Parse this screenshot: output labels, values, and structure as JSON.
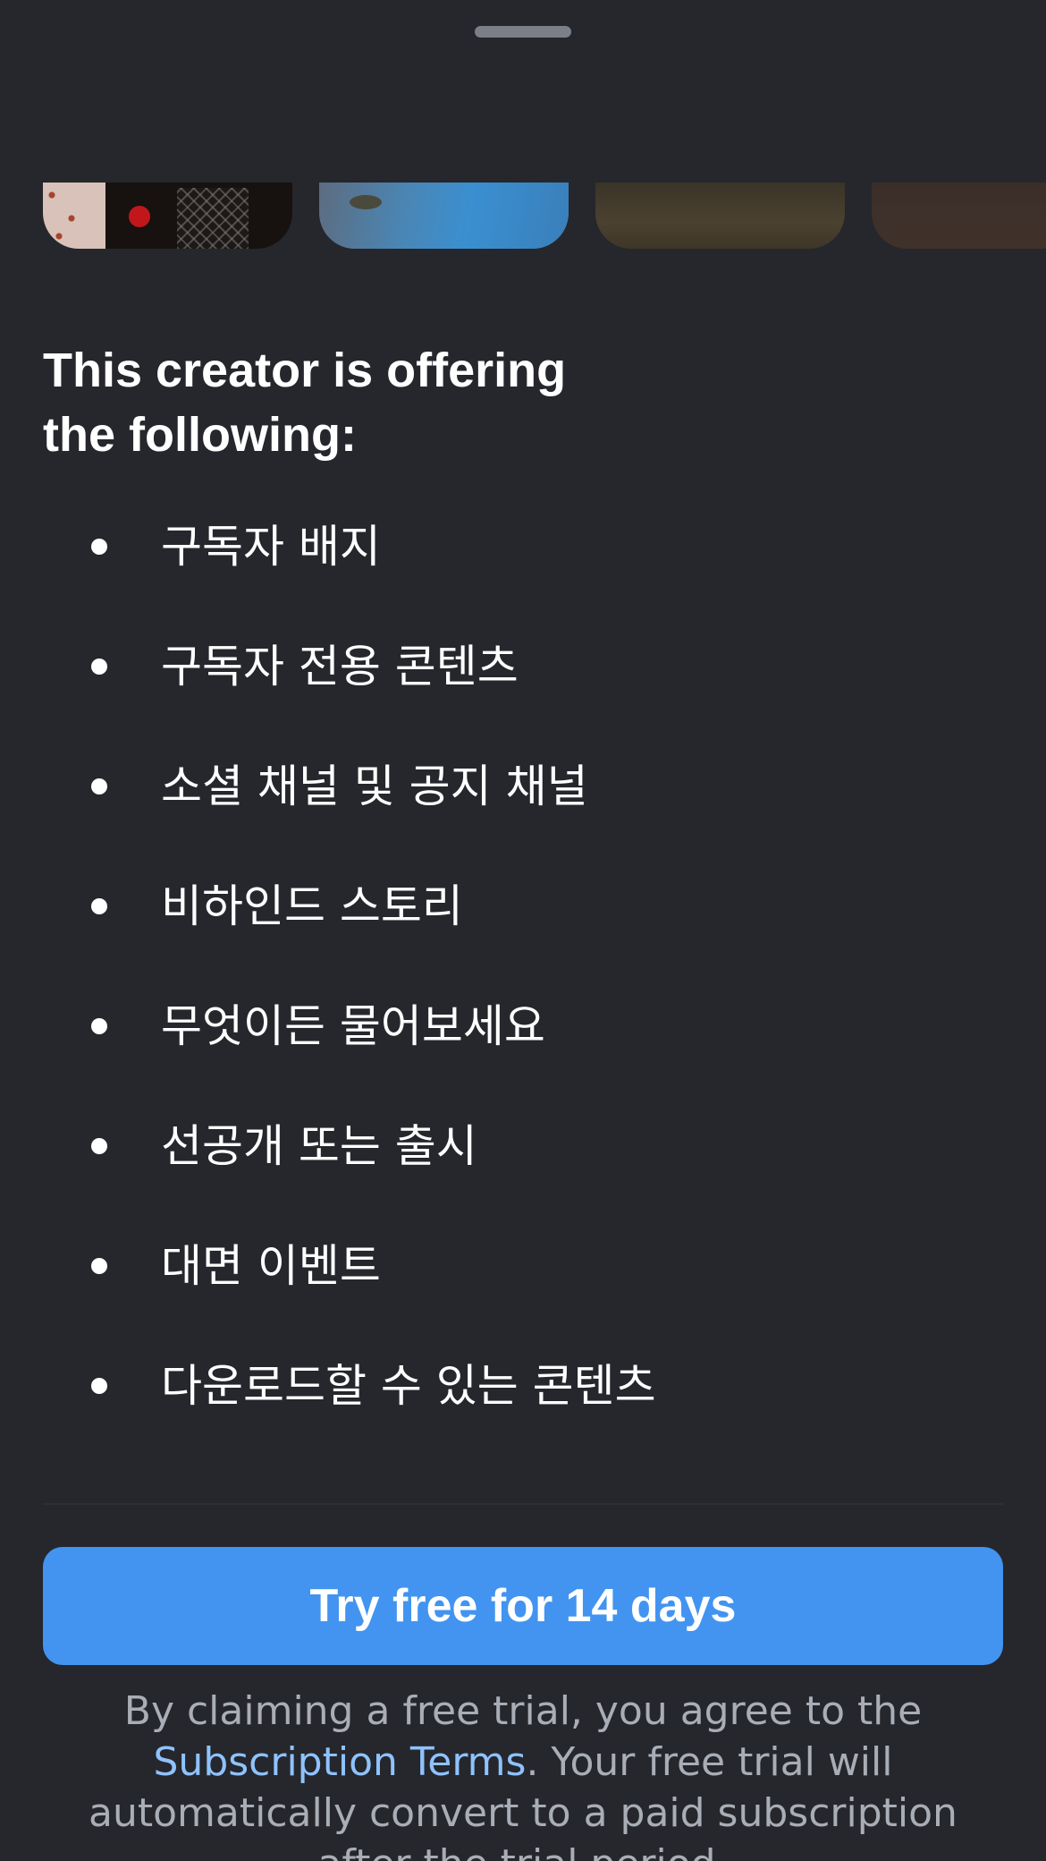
{
  "sheet": {
    "grabber_label": ""
  },
  "thumbnails": [
    {
      "name": "preview-thumbnail-1"
    },
    {
      "name": "preview-thumbnail-2"
    },
    {
      "name": "preview-thumbnail-3"
    },
    {
      "name": "preview-thumbnail-4"
    }
  ],
  "offer": {
    "heading_line1": "This creator is offering",
    "heading_line2": "the following:",
    "benefits": [
      "구독자 배지",
      "구독자 전용 콘텐츠",
      "소셜 채널 및 공지 채널",
      "비하인드 스토리",
      "무엇이든 물어보세요",
      "선공개 또는 출시",
      "대면 이벤트",
      "다운로드할 수 있는 콘텐츠"
    ]
  },
  "cta": {
    "label": "Try free for 14 days"
  },
  "legal": {
    "prefix": "By claiming a free trial, you agree to the ",
    "link": "Subscription Terms",
    "suffix": ". Your free trial will automatically convert to a paid subscription after the trial period."
  },
  "colors": {
    "background": "#25272c",
    "accent": "#4294f0",
    "link": "#8fc2ff",
    "muted_text": "#a9adb5"
  }
}
